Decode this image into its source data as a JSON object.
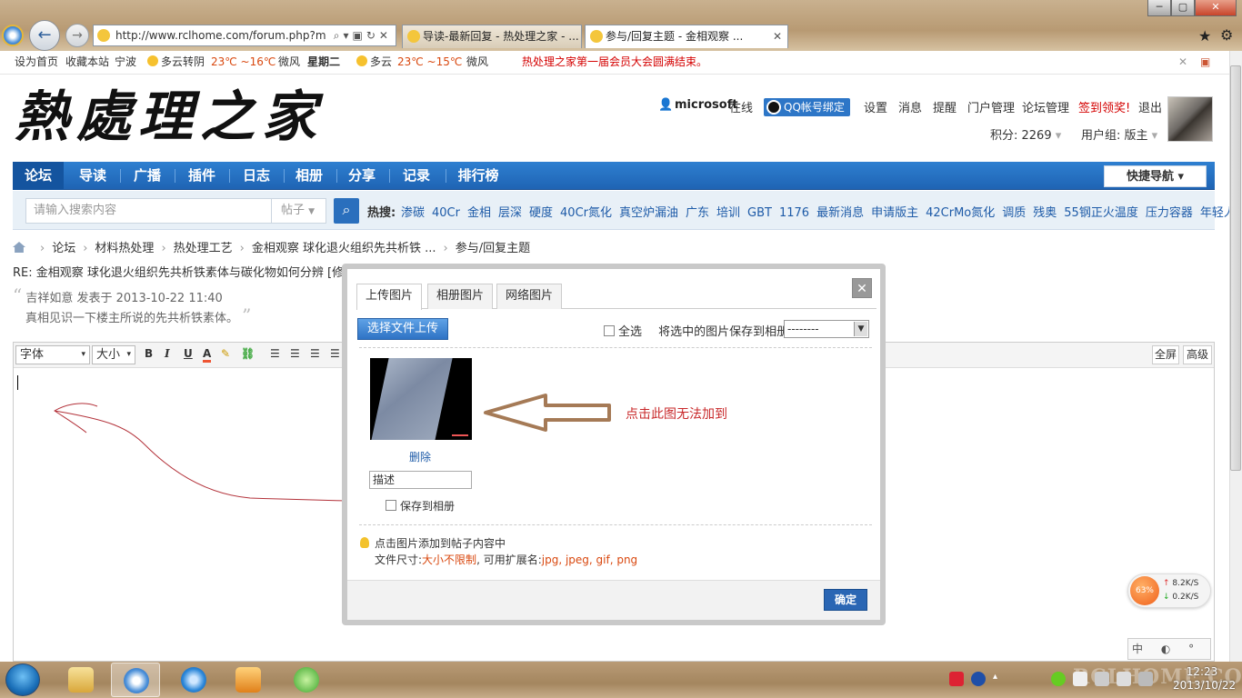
{
  "browser": {
    "address": "http://www.rclhome.com/forum.php?m",
    "tabs": [
      {
        "label": "导读-最新回复 - 热处理之家 - ..."
      },
      {
        "label": "参与/回复主题 - 金相观察 ..."
      }
    ]
  },
  "topbar": {
    "set_home": "设为首页",
    "bookmark": "收藏本站",
    "city": "宁波",
    "weather1": "多云转阴",
    "temp1": "23℃ ~16℃",
    "wind1": "微风",
    "weekday": "星期二",
    "weather2": "多云",
    "temp2": "23℃ ~15℃",
    "wind2": "微风",
    "notice": "热处理之家第一届会员大会圆满结束。"
  },
  "header": {
    "logo": "熱處理之家",
    "username": "microsoft",
    "online": "在线",
    "qq_bind": "QQ帐号绑定",
    "links": [
      "设置",
      "消息",
      "提醒",
      "门户管理",
      "论坛管理",
      "签到领奖!",
      "退出"
    ],
    "credit": "积分: 2269",
    "group": "用户组: 版主"
  },
  "nav": {
    "items": [
      "论坛",
      "导读",
      "广播",
      "插件",
      "日志",
      "相册",
      "分享",
      "记录",
      "排行榜"
    ],
    "quick": "快捷导航"
  },
  "search": {
    "placeholder": "请输入搜索内容",
    "type": "帖子",
    "hot_label": "热搜:",
    "hot": [
      "渗碳",
      "40Cr",
      "金相",
      "层深",
      "硬度",
      "40Cr氮化",
      "真空炉漏油",
      "广东",
      "培训",
      "GBT",
      "1176",
      "最新消息",
      "申请版主",
      "42CrMo氮化",
      "调质",
      "残奥",
      "55钢正火温度",
      "压力容器",
      "年轻人"
    ]
  },
  "breadcrumb": [
    "论坛",
    "材料热处理",
    "热处理工艺",
    "金相观察 球化退火组织先共析铁 ...",
    "参与/回复主题"
  ],
  "post": {
    "retitle": "RE: 金相观察 球化退火组织先共析铁素体与碳化物如何分辨 [修改]",
    "quote_author": "吉祥如意 发表于 2013-10-22 11:40",
    "quote_body": "真相见识一下楼主所说的先共析铁素体。"
  },
  "editor": {
    "font": "字体",
    "size": "大小",
    "b": "B",
    "i": "I",
    "u": "U",
    "a": "A",
    "fullscreen": "全屏",
    "advanced": "高级"
  },
  "dialog": {
    "tabs": [
      "上传图片",
      "相册图片",
      "网络图片"
    ],
    "upload_button": "选择文件上传",
    "select_all": "全选",
    "save_label": "将选中的图片保存到相册:",
    "album_value": "--------",
    "delete": "删除",
    "desc_value": "描述",
    "save_to_album": "保存到相册",
    "hint1": "点击图片添加到帖子内容中",
    "hint2_prefix": "文件尺寸:",
    "hint2_size": "大小不限制",
    "hint2_mid": ", 可用扩展名:",
    "hint2_ext": "jpg, jpeg, gif, png",
    "ok": "确定"
  },
  "annotation": "点击此图无法加到",
  "speed": {
    "percent": "63%",
    "up": "8.2K/S",
    "down": "0.2K/S"
  },
  "ime": "中 ◐ ° ⋮",
  "taskbar": {
    "time": "12:23",
    "date": "2013/10/22",
    "watermark": "RCLHOME.COM"
  },
  "colors": {
    "nav_blue": "#1f64b4",
    "annotation_red": "#c8282a",
    "arrow_brown": "#a57a56"
  }
}
